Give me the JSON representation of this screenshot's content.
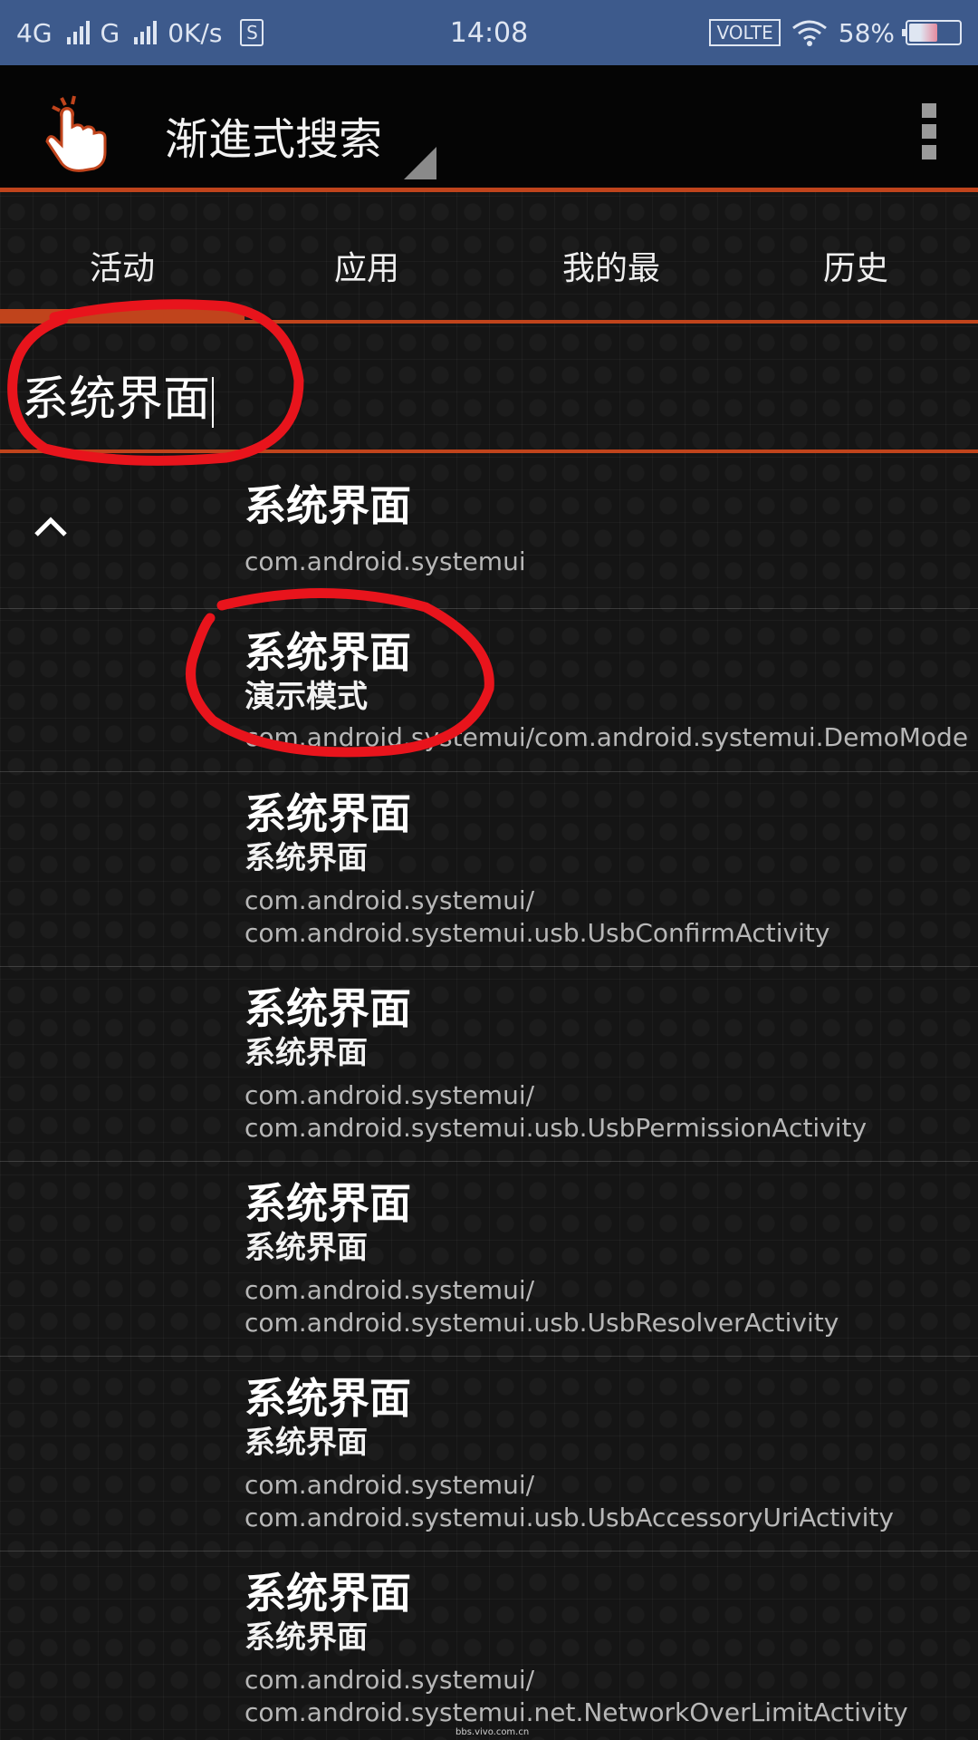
{
  "status_bar": {
    "net1": "4G",
    "net2": "G",
    "speed": "0K/s",
    "sim_label": "S",
    "time": "14:08",
    "volte": "VOLTE",
    "battery": "58%"
  },
  "app_bar": {
    "title": "渐進式搜索",
    "icons": [
      "touch-hand-icon",
      "spinner-triangle-icon",
      "overflow-menu-icon"
    ]
  },
  "tabs": [
    {
      "label": "活动"
    },
    {
      "label": "应用"
    },
    {
      "label": "我的最"
    },
    {
      "label": "历史"
    }
  ],
  "search": {
    "value": "系统界面"
  },
  "results": [
    {
      "title": "系统界面",
      "subtitle": "",
      "pkg1": "com.android.systemui",
      "pkg2": ""
    },
    {
      "title": "系统界面",
      "subtitle": "演示模式",
      "pkg1": "com.android.systemui/com.android.systemui.DemoMode",
      "pkg2": ""
    },
    {
      "title": "系统界面",
      "subtitle": "系统界面",
      "pkg1": "com.android.systemui/",
      "pkg2": "com.android.systemui.usb.UsbConfirmActivity"
    },
    {
      "title": "系统界面",
      "subtitle": "系统界面",
      "pkg1": "com.android.systemui/",
      "pkg2": "com.android.systemui.usb.UsbPermissionActivity"
    },
    {
      "title": "系统界面",
      "subtitle": "系统界面",
      "pkg1": "com.android.systemui/",
      "pkg2": "com.android.systemui.usb.UsbResolverActivity"
    },
    {
      "title": "系统界面",
      "subtitle": "系统界面",
      "pkg1": "com.android.systemui/",
      "pkg2": "com.android.systemui.usb.UsbAccessoryUriActivity"
    },
    {
      "title": "系统界面",
      "subtitle": "系统界面",
      "pkg1": "com.android.systemui/",
      "pkg2": "com.android.systemui.net.NetworkOverLimitActivity"
    }
  ],
  "watermark": "bbs.vivo.com.cn",
  "colors": {
    "accent": "#c0441c",
    "status_bar": "#3d5a8c",
    "annotation_red": "#e8141c"
  }
}
